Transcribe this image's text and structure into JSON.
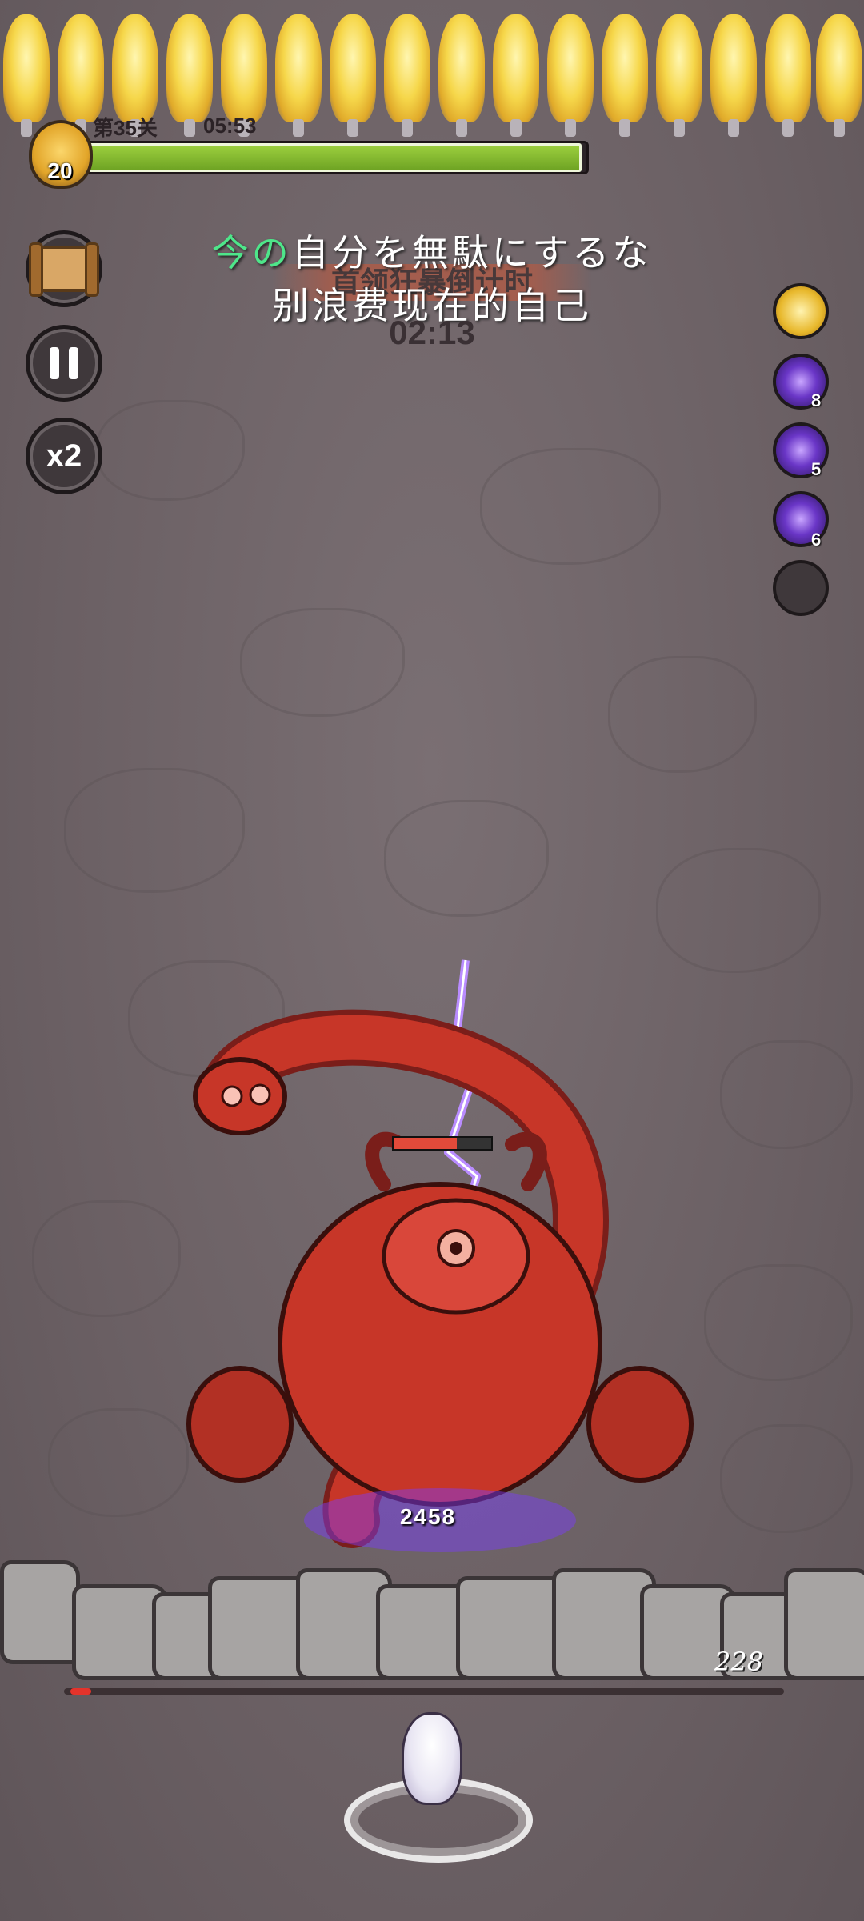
{
  "hud": {
    "stage_label": "第35关",
    "elapsed_time": "05:53",
    "player_level": "20",
    "hp_progress": 0.99
  },
  "left_buttons": {
    "scroll_icon": "scroll-map-icon",
    "pause_icon": "pause-icon",
    "speed_label": "x2"
  },
  "subtitles": {
    "jp_accent": "今の",
    "jp_rest": "自分を無駄にするな",
    "cn": "别浪费现在的自己"
  },
  "boss_rage": {
    "banner": "首领狂暴倒计时",
    "countdown": "02:13"
  },
  "skills": [
    {
      "icon": "golden-wing-icon",
      "count": ""
    },
    {
      "icon": "lightning-skill-icon",
      "count": "8"
    },
    {
      "icon": "lightning-skill-icon",
      "count": "5"
    },
    {
      "icon": "lightning-skill-icon",
      "count": "6"
    },
    {
      "icon": "empty-slot-icon",
      "count": ""
    }
  ],
  "battle": {
    "damage_number": "2458",
    "wall_hp": "228",
    "boss_hp_fraction": 0.65
  },
  "colors": {
    "hp_green": "#8cc236",
    "boss_red": "#c73628",
    "lightning_purple": "#7b3cff",
    "gold": "#f0c83c"
  }
}
